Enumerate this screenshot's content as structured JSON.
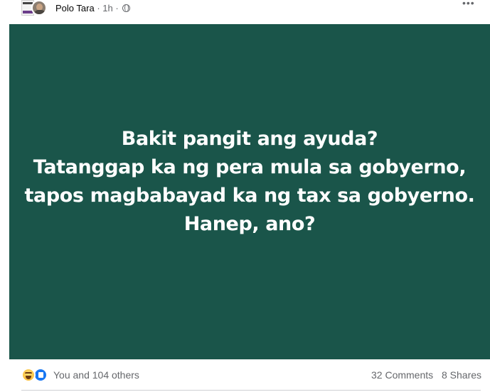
{
  "post": {
    "author": "Polo Tara",
    "separator": "·",
    "time": "1h",
    "privacy_icon": "globe-icon",
    "more_icon": "more-icon"
  },
  "card": {
    "background": "#1a554a",
    "text_color": "#ffffff",
    "lines": [
      "Bakit pangit ang ayuda?",
      "Tatanggap ka ng pera mula sa gobyerno,",
      "tapos magbabayad ka ng tax sa gobyerno.",
      "Hanep, ano?"
    ]
  },
  "footer": {
    "reaction_icons": [
      "haha-icon",
      "like-icon"
    ],
    "reaction_text": "You and 104 others",
    "comments": "32 Comments",
    "shares": "8 Shares"
  }
}
